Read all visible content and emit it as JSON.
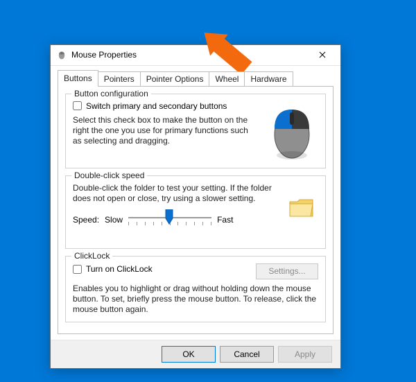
{
  "window": {
    "title": "Mouse Properties"
  },
  "tabs": {
    "items": [
      {
        "label": "Buttons",
        "active": true
      },
      {
        "label": "Pointers"
      },
      {
        "label": "Pointer Options"
      },
      {
        "label": "Wheel"
      },
      {
        "label": "Hardware"
      }
    ]
  },
  "button_config": {
    "legend": "Button configuration",
    "checkbox_label": "Switch primary and secondary buttons",
    "description": "Select this check box to make the button on the right the one you use for primary functions such as selecting and dragging."
  },
  "double_click": {
    "legend": "Double-click speed",
    "description": "Double-click the folder to test your setting. If the folder does not open or close, try using a slower setting.",
    "speed_label": "Speed:",
    "slow_label": "Slow",
    "fast_label": "Fast"
  },
  "click_lock": {
    "legend": "ClickLock",
    "checkbox_label": "Turn on ClickLock",
    "settings_button": "Settings...",
    "description": "Enables you to highlight or drag without holding down the mouse button. To set, briefly press the mouse button. To release, click the mouse button again."
  },
  "footer": {
    "ok": "OK",
    "cancel": "Cancel",
    "apply": "Apply"
  },
  "annotation": {
    "arrow_color": "#f36a0e"
  }
}
